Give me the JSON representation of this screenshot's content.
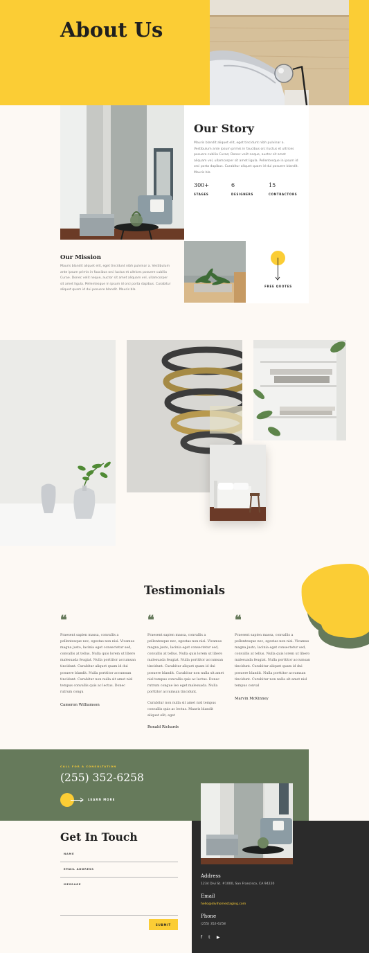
{
  "hero": {
    "title": "About Us"
  },
  "story": {
    "title": "Our Story",
    "body": "Mauris blandit aliquet elit, eget tincidunt nibh pulvinar a. Vestibulum ante ipsum primis in faucibus orci luctus et ultrices posuere cubilia Curae; Donec velit neque, auctor sit amet aliquam vel, ullamcorper sit amet ligula. Pellentesque in ipsum id orci porta dapibus. Curabitur aliquet quam id dui posuere blandit. Mauris bla",
    "stats": [
      {
        "number": "300+",
        "label": "STAGES"
      },
      {
        "number": "6",
        "label": "DESIGNERS"
      },
      {
        "number": "15",
        "label": "CONTRACTORS"
      }
    ],
    "quotes_label": "FREE QUOTES"
  },
  "mission": {
    "title": "Our Mission",
    "body": "Mauris blandit aliquet elit, eget tincidunt nibh pulvinar a. Vestibulum ante ipsum primis in faucibus orci luctus et ultrices posuere cubilia Curae. Donec velit neque, auctor sit amet aliquam vel, ullamcorper sit amet ligula. Pellentesque in ipsum id orci porta dapibus. Curabitur aliquet quam id dui posuere blandit. Mauris bla"
  },
  "testimonials": {
    "title": "Testimonials",
    "items": [
      {
        "quote_mark": "❝",
        "body": "Praesent sapien massa, convallis a pellentesque nec, egestas non nisi. Vivamus magna justo, lacinia eget consectetur sed, convallis at tellus. Nulla quis lorem ut libero malesuada feugiat. Nulla porttitor accumsan tincidunt. Curabitur aliquet quam id dui posuere blandit. Nulla porttitor accumsan tincidunt. Curabitur non nulla sit amet nisl tempus convallis quis ac lectus. Donec rutrum congu",
        "extra": "",
        "name": "Cameron Williamson"
      },
      {
        "quote_mark": "❝",
        "body": "Praesent sapien massa, convallis a pellentesque nec, egestas non nisi. Vivamus magna justo, lacinia eget consectetur sed, convallis at tellus. Nulla quis lorem ut libero malesuada feugiat. Nulla porttitor accumsan tincidunt. Curabitur aliquet quam id dui posuere blandit. Curabitur non nulla sit amet nisl tempus convallis quis ac lectus. Donec rutrum congue leo eget malesuada. Nulla porttitor accumsan tincidunt.",
        "extra": "Curabitur non nulla sit amet nisl tempus convallis quis ac lectus. Mauris blandit aliquet elit, eget",
        "name": "Ronald Richards"
      },
      {
        "quote_mark": "❝",
        "body": "Praesent sapien massa, convallis a pellentesque nec, egestas non nisi. Vivamus magna justo, lacinia eget consectetur sed, convallis at tellus. Nulla quis lorem ut libero malesuada feugiat. Nulla porttitor accumsan tincidunt. Curabitur aliquet quam id dui posuere blandit. Nulla porttitor accumsan tincidunt. Curabitur non nulla sit amet nisl tempus conval",
        "extra": "",
        "name": "Marvin McKinney"
      }
    ]
  },
  "cta": {
    "eyebrow": "CALL FOR A CONSULTATION",
    "phone": "(255) 352-6258",
    "link": "LEARN MORE"
  },
  "contact": {
    "title": "Get In Touch",
    "fields": {
      "name": "NAME",
      "email": "EMAIL ADDRESS",
      "message": "MESSAGE"
    },
    "submit": "SUBMIT",
    "address_label": "Address",
    "address": "1234 Divi St. #1000, San Francisco, CA 94220",
    "email_label": "Email",
    "email": "hello@divihomestaging.com",
    "phone_label": "Phone",
    "phone": "(255) 352-6258",
    "social": {
      "facebook": "f",
      "twitter": "𝕥",
      "youtube": "▶"
    }
  },
  "colors": {
    "accent": "#fbcd35",
    "green": "#667a5b",
    "dark": "#2b2b2b",
    "cream": "#fdf9f4"
  }
}
